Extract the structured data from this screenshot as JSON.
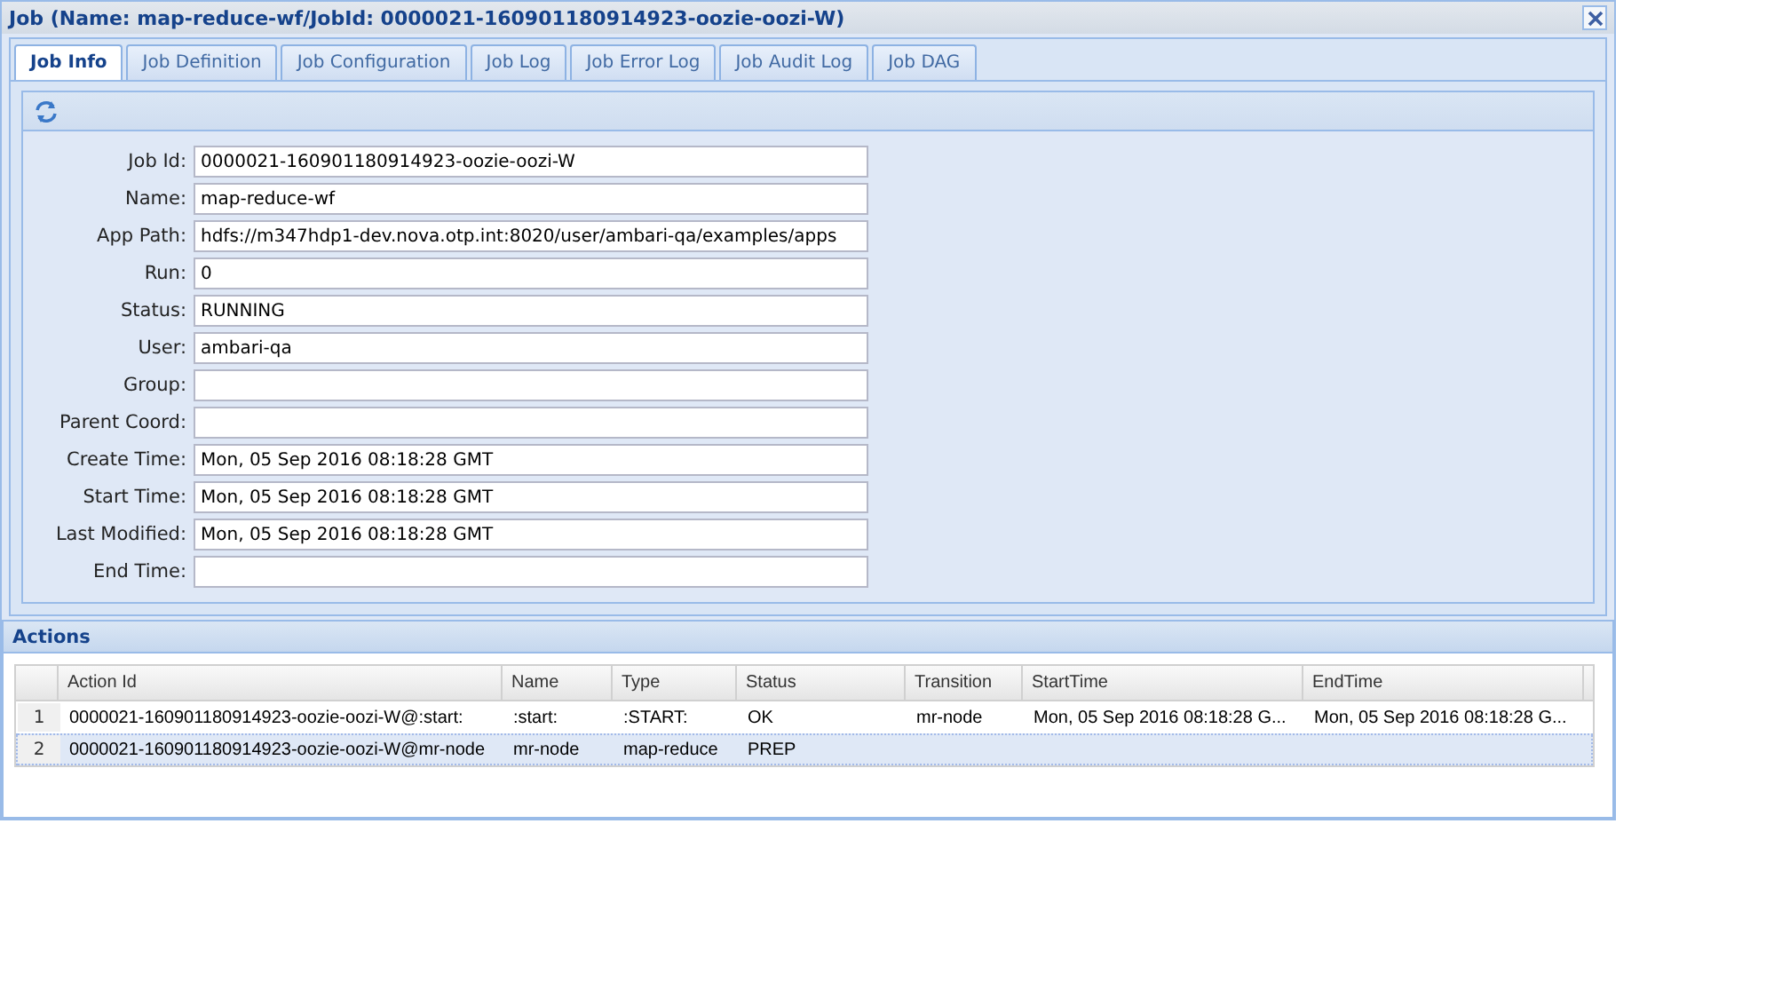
{
  "window": {
    "title": "Job (Name: map-reduce-wf/JobId: 0000021-160901180914923-oozie-oozi-W)"
  },
  "tabs": [
    {
      "label": "Job Info",
      "selected": true
    },
    {
      "label": "Job Definition",
      "selected": false
    },
    {
      "label": "Job Configuration",
      "selected": false
    },
    {
      "label": "Job Log",
      "selected": false
    },
    {
      "label": "Job Error Log",
      "selected": false
    },
    {
      "label": "Job Audit Log",
      "selected": false
    },
    {
      "label": "Job DAG",
      "selected": false
    }
  ],
  "fields": [
    {
      "label": "Job Id:",
      "value": "0000021-160901180914923-oozie-oozi-W"
    },
    {
      "label": "Name:",
      "value": "map-reduce-wf"
    },
    {
      "label": "App Path:",
      "value": "hdfs://m347hdp1-dev.nova.otp.int:8020/user/ambari-qa/examples/apps"
    },
    {
      "label": "Run:",
      "value": "0"
    },
    {
      "label": "Status:",
      "value": "RUNNING"
    },
    {
      "label": "User:",
      "value": "ambari-qa"
    },
    {
      "label": "Group:"
    },
    {
      "label": "Parent Coord:"
    },
    {
      "label": "Create Time:",
      "value": "Mon, 05 Sep 2016 08:18:28 GMT"
    },
    {
      "label": "Start Time:",
      "value": "Mon, 05 Sep 2016 08:18:28 GMT"
    },
    {
      "label": "Last Modified:",
      "value": "Mon, 05 Sep 2016 08:18:28 GMT"
    },
    {
      "label": "End Time:"
    }
  ],
  "actions": {
    "title": "Actions",
    "columns": [
      "Action Id",
      "Name",
      "Type",
      "Status",
      "Transition",
      "StartTime",
      "EndTime"
    ],
    "rows": [
      {
        "number": "1",
        "selected": false,
        "cells": [
          "0000021-160901180914923-oozie-oozi-W@:start:",
          ":start:",
          ":START:",
          "OK",
          "mr-node",
          "Mon, 05 Sep 2016 08:18:28 G...",
          "Mon, 05 Sep 2016 08:18:28 G..."
        ]
      },
      {
        "number": "2",
        "selected": true,
        "cells": [
          "0000021-160901180914923-oozie-oozi-W@mr-node",
          "mr-node",
          "map-reduce",
          "PREP",
          "",
          "",
          ""
        ]
      }
    ]
  }
}
